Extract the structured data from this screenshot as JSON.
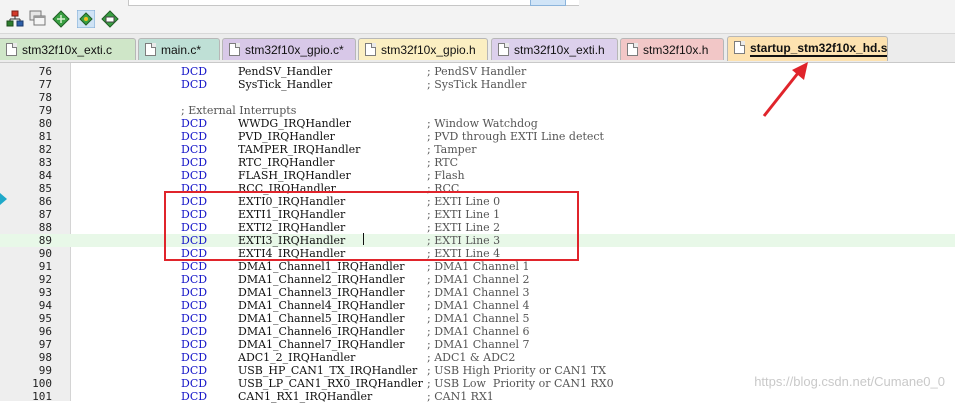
{
  "toolbar": {
    "buttons": [
      {
        "icon": "hierarchy-icon"
      },
      {
        "icon": "window-stack-icon"
      },
      {
        "icon": "green-diamond-icon"
      },
      {
        "icon": "eye-diamond-icon"
      },
      {
        "icon": "target-diamond-icon"
      }
    ]
  },
  "tabs": [
    {
      "label": "stm32f10x_exti.c",
      "color": "#cfe6c8"
    },
    {
      "label": "main.c*",
      "color": "#bfe0d6"
    },
    {
      "label": "stm32f10x_gpio.c*",
      "color": "#d8c8e8"
    },
    {
      "label": "stm32f10x_gpio.h",
      "color": "#fbefc2"
    },
    {
      "label": "stm32f10x_exti.h",
      "color": "#dcd0ec"
    },
    {
      "label": "stm32f10x.h",
      "color": "#f2c7c7"
    },
    {
      "label": "startup_stm32f10x_hd.s",
      "color": "#fde2b0",
      "active": true
    }
  ],
  "editor": {
    "lines": [
      {
        "n": "76",
        "kw": "DCD",
        "sym": "PendSV_Handler",
        "cmt": "; PendSV Handler"
      },
      {
        "n": "77",
        "kw": "DCD",
        "sym": "SysTick_Handler",
        "cmt": "; SysTick Handler"
      },
      {
        "n": "78",
        "kw": "",
        "sym": "",
        "cmt": ""
      },
      {
        "n": "79",
        "kw": "",
        "sym": "",
        "cmt": "",
        "comment": "; External Interrupts"
      },
      {
        "n": "80",
        "kw": "DCD",
        "sym": "WWDG_IRQHandler",
        "cmt": "; Window Watchdog"
      },
      {
        "n": "81",
        "kw": "DCD",
        "sym": "PVD_IRQHandler",
        "cmt": "; PVD through EXTI Line detect"
      },
      {
        "n": "82",
        "kw": "DCD",
        "sym": "TAMPER_IRQHandler",
        "cmt": "; Tamper"
      },
      {
        "n": "83",
        "kw": "DCD",
        "sym": "RTC_IRQHandler",
        "cmt": "; RTC"
      },
      {
        "n": "84",
        "kw": "DCD",
        "sym": "FLASH_IRQHandler",
        "cmt": "; Flash"
      },
      {
        "n": "85",
        "kw": "DCD",
        "sym": "RCC_IRQHandler",
        "cmt": "; RCC"
      },
      {
        "n": "86",
        "kw": "DCD",
        "sym": "EXTI0_IRQHandler",
        "cmt": "; EXTI Line 0"
      },
      {
        "n": "87",
        "kw": "DCD",
        "sym": "EXTI1_IRQHandler",
        "cmt": "; EXTI Line 1"
      },
      {
        "n": "88",
        "kw": "DCD",
        "sym": "EXTI2_IRQHandler",
        "cmt": "; EXTI Line 2"
      },
      {
        "n": "89",
        "kw": "DCD",
        "sym": "EXTI3_IRQHandler",
        "cmt": "; EXTI Line 3",
        "highlighted": true
      },
      {
        "n": "90",
        "kw": "DCD",
        "sym": "EXTI4_IRQHandler",
        "cmt": "; EXTI Line 4"
      },
      {
        "n": "91",
        "kw": "DCD",
        "sym": "DMA1_Channel1_IRQHandler",
        "cmt": "; DMA1 Channel 1"
      },
      {
        "n": "92",
        "kw": "DCD",
        "sym": "DMA1_Channel2_IRQHandler",
        "cmt": "; DMA1 Channel 2"
      },
      {
        "n": "93",
        "kw": "DCD",
        "sym": "DMA1_Channel3_IRQHandler",
        "cmt": "; DMA1 Channel 3"
      },
      {
        "n": "94",
        "kw": "DCD",
        "sym": "DMA1_Channel4_IRQHandler",
        "cmt": "; DMA1 Channel 4"
      },
      {
        "n": "95",
        "kw": "DCD",
        "sym": "DMA1_Channel5_IRQHandler",
        "cmt": "; DMA1 Channel 5"
      },
      {
        "n": "96",
        "kw": "DCD",
        "sym": "DMA1_Channel6_IRQHandler",
        "cmt": "; DMA1 Channel 6"
      },
      {
        "n": "97",
        "kw": "DCD",
        "sym": "DMA1_Channel7_IRQHandler",
        "cmt": "; DMA1 Channel 7"
      },
      {
        "n": "98",
        "kw": "DCD",
        "sym": "ADC1_2_IRQHandler",
        "cmt": "; ADC1 & ADC2"
      },
      {
        "n": "99",
        "kw": "DCD",
        "sym": "USB_HP_CAN1_TX_IRQHandler",
        "cmt": "; USB High Priority or CAN1 TX"
      },
      {
        "n": "100",
        "kw": "DCD",
        "sym": "USB_LP_CAN1_RX0_IRQHandler",
        "cmt": "; USB Low  Priority or CAN1 RX0"
      },
      {
        "n": "101",
        "kw": "DCD",
        "sym": "CAN1_RX1_IRQHandler",
        "cmt": "; CAN1 RX1"
      }
    ]
  },
  "watermark": "https://blog.csdn.net/Cumane0_0",
  "colors": {
    "annotation": "#e0242b",
    "keyword": "#1414c8",
    "highlight_line": "#e8f8e8"
  }
}
